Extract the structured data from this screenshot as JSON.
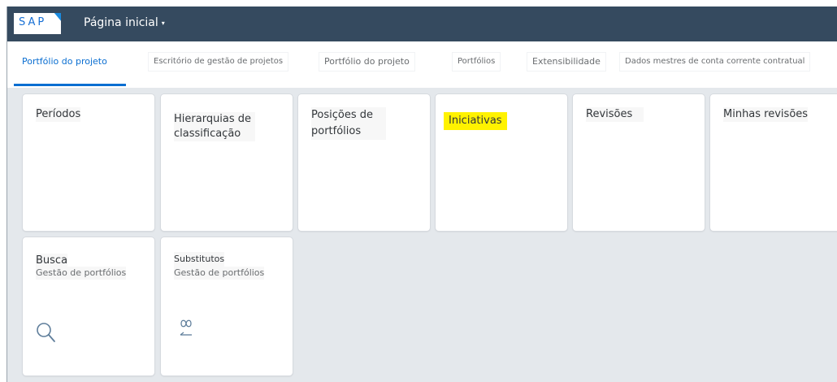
{
  "shell": {
    "logo": "SAP",
    "title": "Página inicial",
    "caret": "▾"
  },
  "tabs": [
    {
      "label": "Portfólio do projeto",
      "active": true
    },
    {
      "label": "Escritório de gestão de projetos"
    },
    {
      "label": "Portfólio do projeto"
    },
    {
      "label": "Portfólios"
    },
    {
      "label": "Extensibilidade"
    },
    {
      "label": "Dados mestres de conta corrente contratual"
    }
  ],
  "tiles": [
    {
      "title": "Períodos"
    },
    {
      "title": "Hierarquias de classificação"
    },
    {
      "title": "Posições de portfólios"
    },
    {
      "title": "Iniciativas",
      "highlighted": true
    },
    {
      "title": "Revisões"
    },
    {
      "title": "Minhas revisões"
    },
    {
      "title": "Busca",
      "subtitle": "Gestão de portfólios",
      "icon": "search-icon"
    },
    {
      "title": "Substitutos",
      "subtitle": "Gestão de portfólios",
      "icon": "substitute-icon"
    }
  ],
  "colors": {
    "shell": "#354a5f",
    "accent": "#0a6ed1",
    "highlight": "#fff200"
  }
}
